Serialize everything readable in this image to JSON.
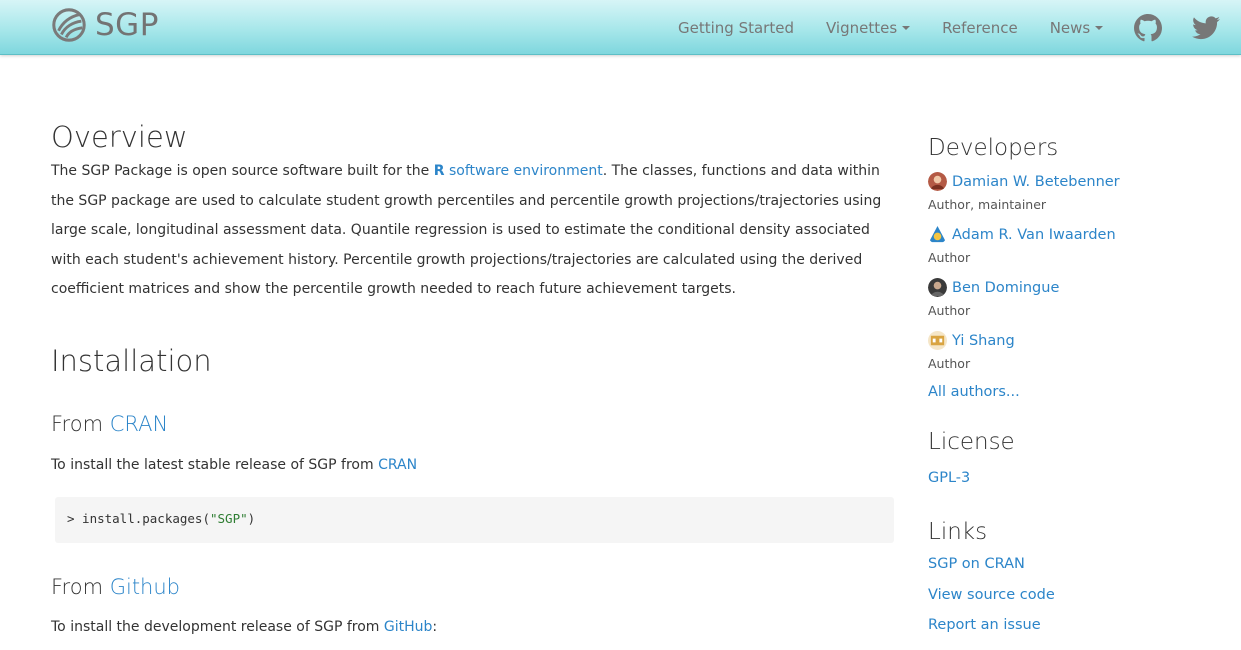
{
  "nav": {
    "brand": "SGP",
    "items": [
      {
        "label": "Getting Started"
      },
      {
        "label": "Vignettes"
      },
      {
        "label": "Reference"
      },
      {
        "label": "News"
      }
    ]
  },
  "overview": {
    "heading": "Overview",
    "text_before": "The SGP Package is open source software built for the ",
    "r_label": "R",
    "link_text": "software environment",
    "text_after": ". The classes, functions and data within the SGP package are used to calculate student growth percentiles and percentile growth projections/trajectories using large scale, longitudinal assessment data. Quantile regression is used to estimate the conditional density associated with each student's achievement history. Percentile growth projections/trajectories are calculated using the derived coefficient matrices and show the percentile growth needed to reach future achievement targets."
  },
  "installation": {
    "heading": "Installation",
    "cran": {
      "heading_prefix": "From ",
      "heading_link": "CRAN",
      "text": "To install the latest stable release of SGP from ",
      "text_link": "CRAN",
      "code_prompt": "> install.packages(",
      "code_string": "\"SGP\"",
      "code_end": ")"
    },
    "github": {
      "heading_prefix": "From ",
      "heading_link": "Github",
      "text": "To install the development release of SGP from ",
      "text_link": "GitHub",
      "text_end": ":"
    }
  },
  "sidebar": {
    "developers_heading": "Developers",
    "developers": [
      {
        "name": "Damian W. Betebenner",
        "role": "Author, maintainer"
      },
      {
        "name": "Adam R. Van Iwaarden",
        "role": "Author"
      },
      {
        "name": "Ben Domingue",
        "role": "Author"
      },
      {
        "name": "Yi Shang",
        "role": "Author"
      }
    ],
    "all_authors": "All authors...",
    "license_heading": "License",
    "license": "GPL-3",
    "links_heading": "Links",
    "links": [
      "SGP on CRAN",
      "View source code",
      "Report an issue"
    ]
  },
  "colors": {
    "link": "#2c85c9",
    "navbar": "#a7e7ea",
    "code_bg": "#f5f5f5"
  }
}
